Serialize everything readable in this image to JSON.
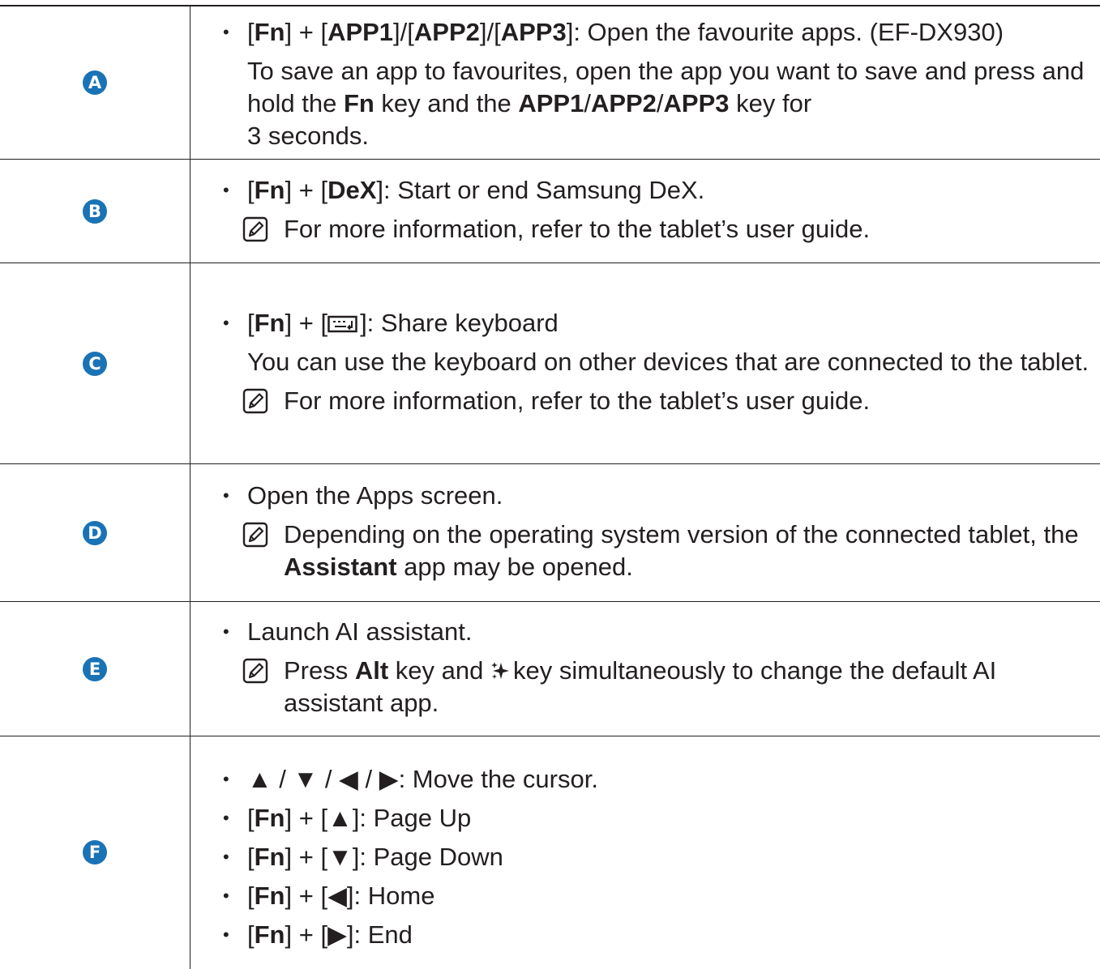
{
  "rows": [
    {
      "label": "A",
      "bullets": [
        {
          "pre": "[",
          "k1": "Fn",
          "mid1": "] + [",
          "k2": "APP1",
          "mid2": "]/[",
          "k3": "APP2",
          "mid3": "]/[",
          "k4": "APP3",
          "post": "]: Open the favourite apps. (EF-DX930)"
        }
      ],
      "para": {
        "t1": "To save an app to favourites, open the app you want to save and press and hold the ",
        "k1": "Fn",
        "t2": " key and the ",
        "k2": "APP1",
        "s1": "/",
        "k3": "APP2",
        "s2": "/",
        "k4": "APP3",
        "t3": " key for",
        "t4": "3 seconds."
      }
    },
    {
      "label": "B",
      "bullet": {
        "pre": "[",
        "k1": "Fn",
        "mid": "] + [",
        "k2": "DeX",
        "post": "]: Start or end Samsung DeX."
      },
      "note": "For more information, refer to the tablet’s user guide."
    },
    {
      "label": "C",
      "bullet": {
        "pre": "[",
        "k1": "Fn",
        "mid": "] + [",
        "post": "]: Share keyboard"
      },
      "para": "You can use the keyboard on other devices that are connected to the tablet.",
      "note": "For more information, refer to the tablet’s user guide."
    },
    {
      "label": "D",
      "bullet": "Open the Apps screen.",
      "note": {
        "t1": "Depending on the operating system version of the connected tablet, the ",
        "k1": "Assistant",
        "t2": " app may be opened."
      }
    },
    {
      "label": "E",
      "bullet": "Launch AI assistant.",
      "note": {
        "t1": "Press ",
        "k1": "Alt",
        "t2": " key and ",
        "t3": "key simultaneously to change the default AI assistant app."
      }
    },
    {
      "label": "F",
      "arrows": "▲ / ▼ / ◀ / ▶",
      "arrows_post": ": Move the cursor.",
      "items": [
        {
          "pre": "[",
          "k": "Fn",
          "mid": "] + [",
          "arrow": "▲",
          "post": "]: Page Up"
        },
        {
          "pre": "[",
          "k": "Fn",
          "mid": "] + [",
          "arrow": "▼",
          "post": "]: Page Down"
        },
        {
          "pre": "[",
          "k": "Fn",
          "mid": "] + [",
          "arrow": "◀",
          "post": "]: Home"
        },
        {
          "pre": "[",
          "k": "Fn",
          "mid": "] + [",
          "arrow": "▶",
          "post": "]: End"
        }
      ]
    }
  ]
}
